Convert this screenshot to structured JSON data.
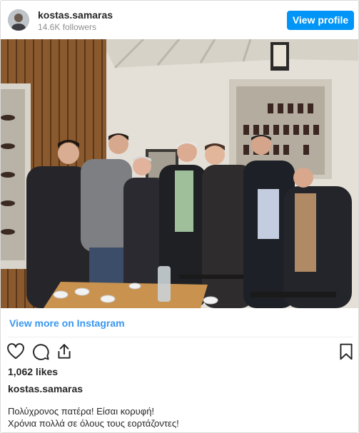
{
  "header": {
    "username": "kostas.samaras",
    "followers": "14.6K followers",
    "view_profile_label": "View profile"
  },
  "post": {
    "view_more_label": "View more on Instagram",
    "likes": "1,062 likes",
    "caption_user": "kostas.samaras",
    "caption_lines": [
      "Πολύχρονος πατέρα! Είσαι κορυφή!",
      "Χρόνια πολλά σε όλους τους εορτάζοντες!"
    ]
  },
  "icons": {
    "like": "heart-icon",
    "comment": "comment-icon",
    "share": "share-icon",
    "save": "bookmark-icon"
  },
  "colors": {
    "button": "#0095f6",
    "link": "#3897f0",
    "text": "#262626",
    "muted": "#8e8e8e"
  }
}
